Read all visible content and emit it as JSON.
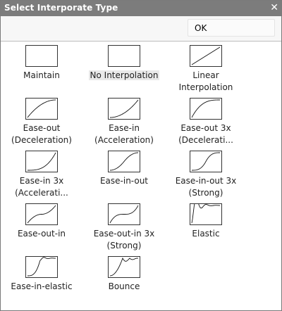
{
  "window": {
    "title": "Select Interporate Type",
    "close_glyph": "✕"
  },
  "toolbar": {
    "ok_label": "OK"
  },
  "items": [
    {
      "label": "Maintain",
      "curve": "maintain",
      "selected": false
    },
    {
      "label": "No Interpolation",
      "curve": "none",
      "selected": true
    },
    {
      "label": "Linear\nInterpolation",
      "curve": "linear",
      "selected": false
    },
    {
      "label": "Ease-out\n(Deceleration)",
      "curve": "ease-out",
      "selected": false
    },
    {
      "label": "Ease-in\n(Acceleration)",
      "curve": "ease-in",
      "selected": false
    },
    {
      "label": "Ease-out 3x\n(Decelerati...",
      "curve": "ease-out-3x",
      "selected": false
    },
    {
      "label": "Ease-in 3x\n(Accelerati...",
      "curve": "ease-in-3x",
      "selected": false
    },
    {
      "label": "Ease-in-out",
      "curve": "ease-in-out",
      "selected": false
    },
    {
      "label": "Ease-in-out 3x\n(Strong)",
      "curve": "ease-in-out-3x",
      "selected": false
    },
    {
      "label": "Ease-out-in",
      "curve": "ease-out-in",
      "selected": false
    },
    {
      "label": "Ease-out-in 3x\n(Strong)",
      "curve": "ease-out-in-3x",
      "selected": false
    },
    {
      "label": "Elastic",
      "curve": "elastic",
      "selected": false
    },
    {
      "label": "Ease-in-elastic",
      "curve": "ease-in-elastic",
      "selected": false
    },
    {
      "label": "Bounce",
      "curve": "bounce",
      "selected": false
    }
  ]
}
